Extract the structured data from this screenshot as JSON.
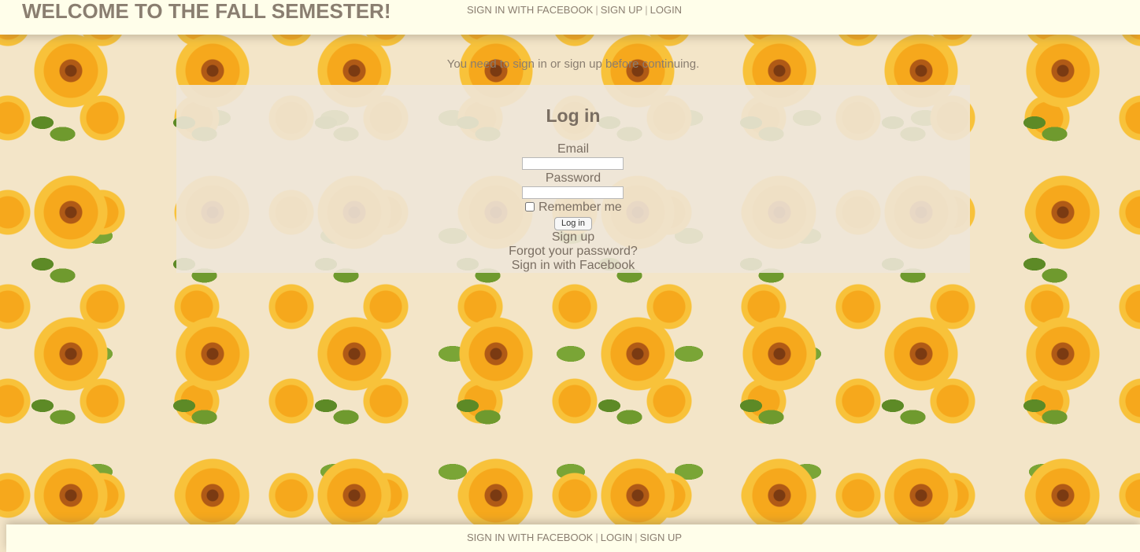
{
  "header": {
    "title": "WELCOME TO THE FALL SEMESTER!",
    "nav": {
      "facebook": "SIGN IN WITH FACEBOOK",
      "signup": "SIGN UP",
      "login": "LOGIN",
      "separator": "|"
    }
  },
  "notice": "You need to sign in or sign up before continuing.",
  "login_form": {
    "heading": "Log in",
    "email_label": "Email",
    "email_value": "",
    "password_label": "Password",
    "password_value": "",
    "remember_label": "Remember me",
    "submit_label": "Log in",
    "links": {
      "signup": "Sign up",
      "forgot": "Forgot your password?",
      "facebook": "Sign in with Facebook"
    }
  },
  "footer": {
    "nav": {
      "facebook": "SIGN IN WITH FACEBOOK",
      "login": "LOGIN",
      "signup": "SIGN UP",
      "separator": "|"
    }
  },
  "colors": {
    "bar_background": "#fffeea",
    "text": "#8a7e70",
    "panel": "#eee6d8",
    "page_background": "#f3e5c8"
  }
}
